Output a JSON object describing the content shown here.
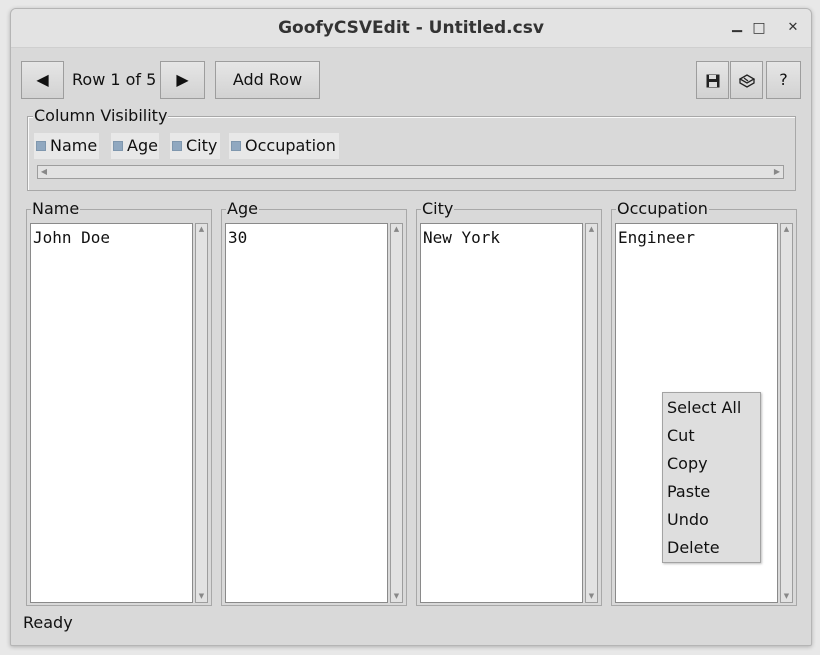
{
  "window": {
    "title": "GoofyCSVEdit - Untitled.csv",
    "minimize_icon": "▁",
    "maximize_icon": "□",
    "close_icon": "✕"
  },
  "toolbar": {
    "prev_icon": "◀",
    "row_label": "Row 1 of 5",
    "next_icon": "▶",
    "add_row_label": "Add Row",
    "save_icon": "floppy-disk-icon",
    "saveas_icon": "save-as-icon",
    "help_label": "?"
  },
  "visibility": {
    "title": "Column Visibility",
    "items": [
      "Name",
      "Age",
      "City",
      "Occupation"
    ]
  },
  "columns": [
    {
      "header": "Name",
      "value": "John Doe"
    },
    {
      "header": "Age",
      "value": "30"
    },
    {
      "header": "City",
      "value": "New York"
    },
    {
      "header": "Occupation",
      "value": "Engineer"
    }
  ],
  "context_menu": {
    "items": [
      "Select All",
      "Cut",
      "Copy",
      "Paste",
      "Undo",
      "Delete"
    ]
  },
  "status": "Ready"
}
